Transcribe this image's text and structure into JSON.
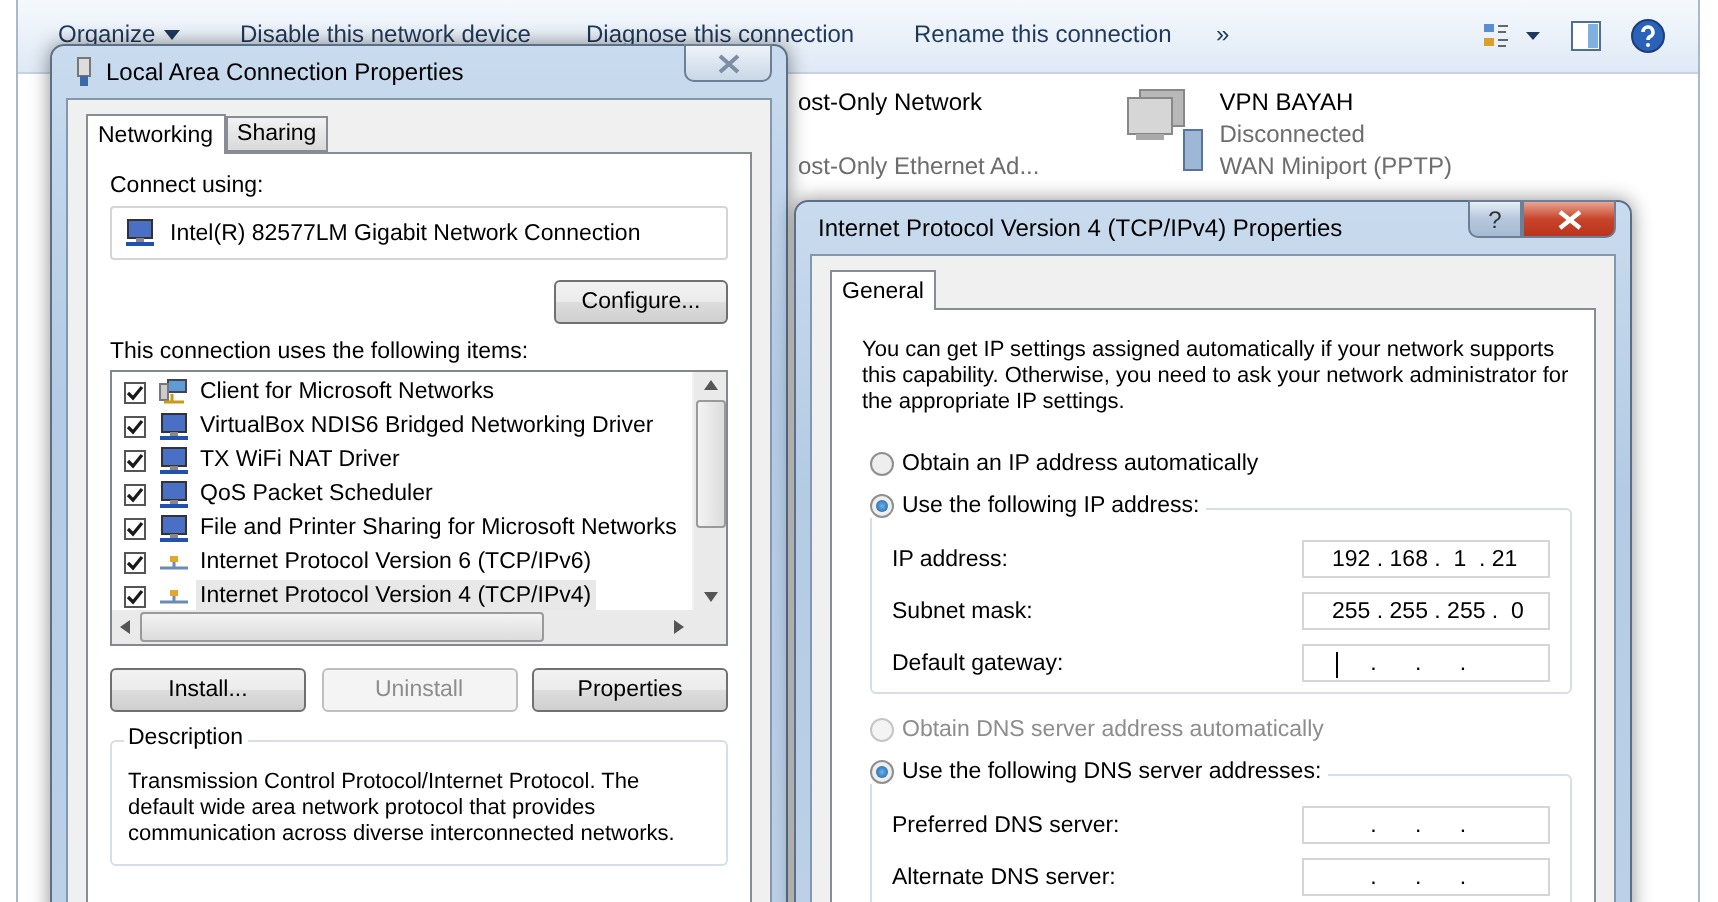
{
  "explorer": {
    "toolbar": [
      {
        "label": "Organize",
        "kind": "menu"
      },
      {
        "label": "Disable this network device",
        "kind": "plain"
      },
      {
        "label": "Diagnose this connection",
        "kind": "plain"
      },
      {
        "label": "Rename this connection",
        "kind": "plain"
      },
      {
        "label": "»",
        "kind": "plain"
      }
    ],
    "connections": [
      {
        "kind": "partial",
        "name": "ost-Only Network",
        "detail": "ost-Only Ethernet Ad..."
      },
      {
        "kind": "vpn",
        "name": "VPN BAYAH",
        "status": "Disconnected",
        "detail": "WAN Miniport (PPTP)"
      }
    ]
  },
  "lan_dialog": {
    "title": "Local Area Connection Properties",
    "tabs": [
      {
        "label": "Networking",
        "selected": true
      },
      {
        "label": "Sharing",
        "selected": false
      }
    ],
    "connect_using_label": "Connect using:",
    "adapter": "Intel(R) 82577LM Gigabit Network Connection",
    "configure_button": "Configure...",
    "items_label": "This connection uses the following items:",
    "items": [
      {
        "label": "Client for Microsoft Networks",
        "checked": true,
        "selected": false,
        "kind": "client"
      },
      {
        "label": "VirtualBox NDIS6 Bridged Networking Driver",
        "checked": true,
        "selected": false,
        "kind": "service"
      },
      {
        "label": "TX WiFi NAT Driver",
        "checked": true,
        "selected": false,
        "kind": "service"
      },
      {
        "label": "QoS Packet Scheduler",
        "checked": true,
        "selected": false,
        "kind": "service"
      },
      {
        "label": "File and Printer Sharing for Microsoft Networks",
        "checked": true,
        "selected": false,
        "kind": "service"
      },
      {
        "label": "Internet Protocol Version 6 (TCP/IPv6)",
        "checked": true,
        "selected": false,
        "kind": "protocol"
      },
      {
        "label": "Internet Protocol Version 4 (TCP/IPv4)",
        "checked": true,
        "selected": true,
        "kind": "protocol"
      }
    ],
    "buttons": [
      {
        "label": "Install...",
        "disabled": false
      },
      {
        "label": "Uninstall",
        "disabled": true
      },
      {
        "label": "Properties",
        "disabled": false
      }
    ],
    "description": {
      "title": "Description",
      "text": "Transmission Control Protocol/Internet Protocol. The default wide area network protocol that provides communication across diverse interconnected networks."
    }
  },
  "ipv4_dialog": {
    "title": "Internet Protocol Version 4 (TCP/IPv4) Properties",
    "help_button": "?",
    "tabs": [
      {
        "label": "General",
        "selected": true
      }
    ],
    "intro": "You can get IP settings assigned automatically if your network supports this capability. Otherwise, you need to ask your network administrator for the appropriate IP settings.",
    "ip_options": [
      {
        "label": "Obtain an IP address automatically",
        "selected": false,
        "disabled": false
      },
      {
        "label": "Use the following IP address:",
        "selected": true,
        "disabled": false
      }
    ],
    "ip_fields": [
      {
        "label": "IP address:",
        "value": "192 . 168 .  1  . 21",
        "focused": false
      },
      {
        "label": "Subnet mask:",
        "value": "255 . 255 . 255 .  0",
        "focused": false
      },
      {
        "label": "Default gateway:",
        "value": "      .      .      .",
        "focused": true
      }
    ],
    "dns_options": [
      {
        "label": "Obtain DNS server address automatically",
        "selected": false,
        "disabled": true
      },
      {
        "label": "Use the following DNS server addresses:",
        "selected": true,
        "disabled": false
      }
    ],
    "dns_fields": [
      {
        "label": "Preferred DNS server:",
        "value": "      .      .      .",
        "focused": false
      },
      {
        "label": "Alternate DNS server:",
        "value": "      .      .      .",
        "focused": false
      }
    ]
  }
}
